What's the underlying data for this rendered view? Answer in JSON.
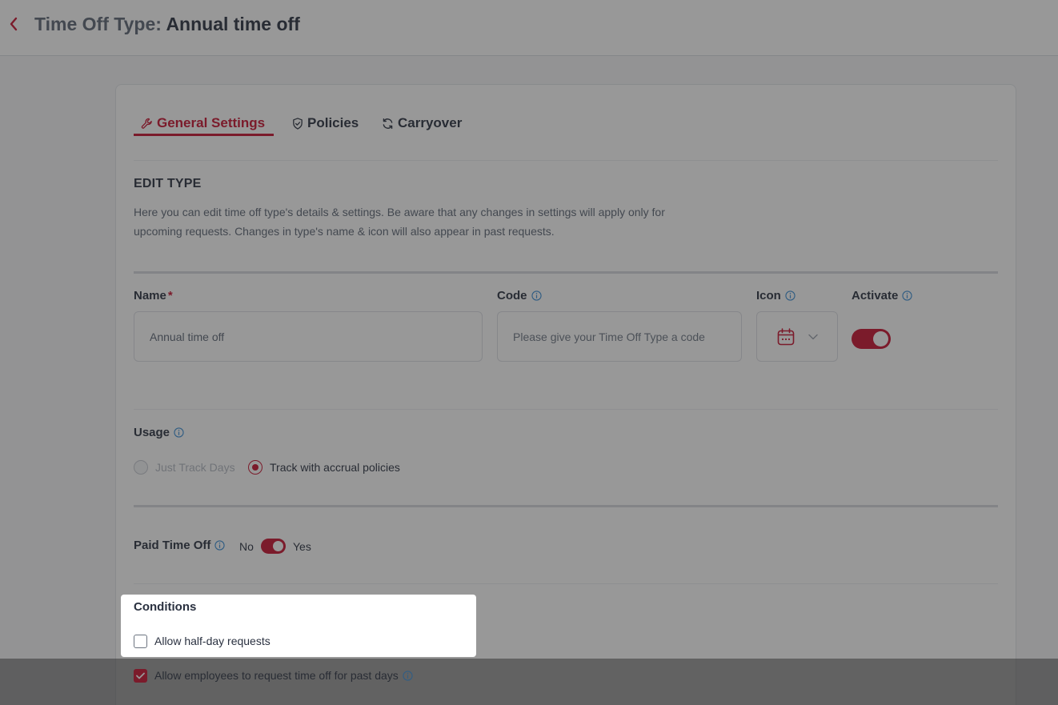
{
  "header": {
    "title_prefix": "Time Off Type:",
    "title_name": "Annual time off"
  },
  "tabs": [
    {
      "label": "General Settings",
      "icon": "wrench-icon",
      "active": true
    },
    {
      "label": "Policies",
      "icon": "shield-check-icon",
      "active": false
    },
    {
      "label": "Carryover",
      "icon": "refresh-icon",
      "active": false
    }
  ],
  "edit_type": {
    "title": "EDIT TYPE",
    "description": "Here you can edit time off type's details & settings. Be aware that any changes in settings will apply only for upcoming requests. Changes in type's name & icon will also appear in past requests."
  },
  "fields": {
    "name_label": "Name",
    "name_required": "*",
    "name_value": "Annual time off",
    "code_label": "Code",
    "code_placeholder": "Please give your Time Off Type a code",
    "icon_label": "Icon",
    "icon_selected": "calendar-icon",
    "activate_label": "Activate",
    "activate_on": true
  },
  "usage": {
    "label": "Usage",
    "options": [
      {
        "label": "Just Track Days",
        "checked": false,
        "disabled": true
      },
      {
        "label": "Track with accrual policies",
        "checked": true,
        "disabled": false
      }
    ]
  },
  "paid_time_off": {
    "label": "Paid Time Off",
    "no_label": "No",
    "yes_label": "Yes",
    "value": true
  },
  "conditions": {
    "title": "Conditions",
    "items": [
      {
        "label": "Allow half-day requests",
        "checked": false
      },
      {
        "label": "Allow employees to request time off for past days",
        "checked": true
      }
    ]
  },
  "colors": {
    "accent": "#c8102e",
    "info": "#3a8fd6",
    "text": "#2a3140",
    "muted": "#5d6776"
  }
}
